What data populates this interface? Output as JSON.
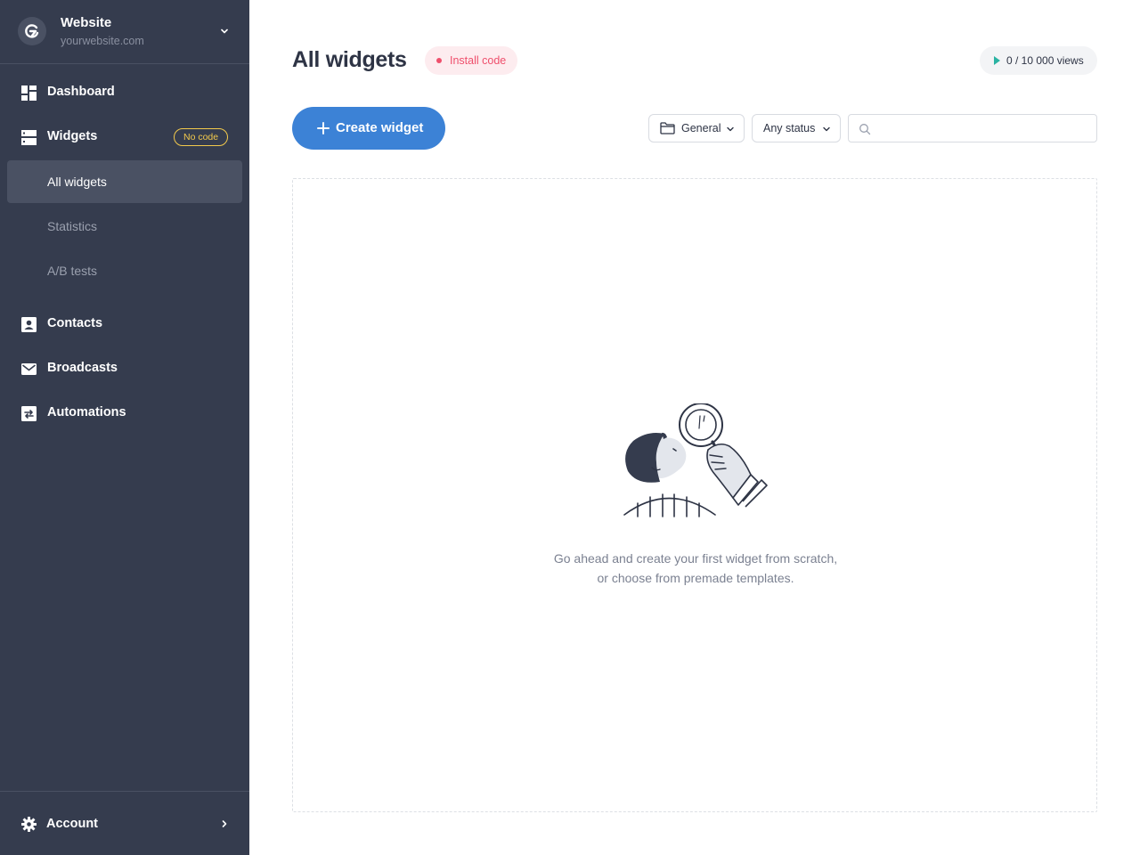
{
  "sidebar": {
    "site": {
      "name": "Website",
      "url": "yourwebsite.com"
    },
    "nav": [
      {
        "id": "dashboard",
        "label": "Dashboard",
        "icon": "dashboard-icon"
      },
      {
        "id": "widgets",
        "label": "Widgets",
        "icon": "widgets-icon",
        "badge": "No code"
      },
      {
        "id": "contacts",
        "label": "Contacts",
        "icon": "contacts-icon"
      },
      {
        "id": "broadcasts",
        "label": "Broadcasts",
        "icon": "mail-icon"
      },
      {
        "id": "automations",
        "label": "Automations",
        "icon": "automations-icon"
      }
    ],
    "widgets_sub": [
      {
        "label": "All widgets",
        "active": true
      },
      {
        "label": "Statistics",
        "active": false
      },
      {
        "label": "A/B tests",
        "active": false
      }
    ],
    "account": {
      "label": "Account",
      "icon": "gear-icon"
    }
  },
  "header": {
    "title": "All widgets",
    "install_badge": "Install code",
    "views": "0 / 10 000 views"
  },
  "toolbar": {
    "create_label": "Create widget",
    "folder_filter": "General",
    "status_filter": "Any status",
    "search": {
      "value": "",
      "placeholder": ""
    }
  },
  "empty_state": {
    "line1": "Go ahead and create your first widget from scratch,",
    "line2": "or choose from premade templates."
  },
  "colors": {
    "sidebar_bg": "#353c4e",
    "sidebar_active": "#4a5163",
    "accent": "#3c82d6",
    "badge_yellow": "#f2c94c",
    "install_red": "#ef4f6c",
    "install_bg": "#fdecef",
    "views_play": "#2bb3a3"
  }
}
